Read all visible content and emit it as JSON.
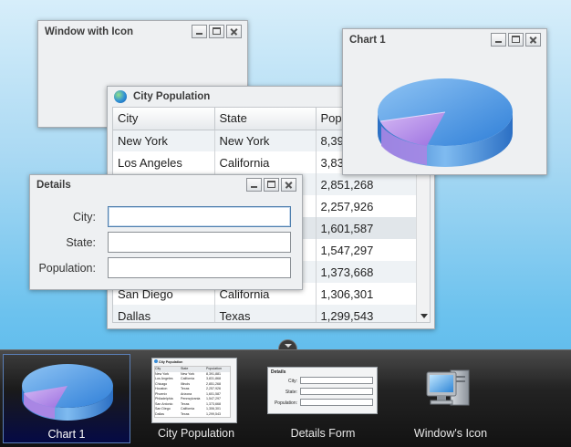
{
  "windows": {
    "icon_window": {
      "title": "Window with Icon"
    },
    "chart_window": {
      "title": "Chart 1"
    },
    "population": {
      "title": "City Population",
      "columns": [
        "City",
        "State",
        "Popula"
      ],
      "rows": [
        {
          "city": "New York",
          "state": "New York",
          "pop": "8,39"
        },
        {
          "city": "Los Angeles",
          "state": "California",
          "pop": "3,83"
        },
        {
          "city": "",
          "state": "",
          "pop": "2,851,268"
        },
        {
          "city": "",
          "state": "",
          "pop": "2,257,926"
        },
        {
          "city": "",
          "state": "",
          "pop": "1,601,587"
        },
        {
          "city": "",
          "state": "",
          "pop": "1,547,297"
        },
        {
          "city": "",
          "state": "",
          "pop": "1,373,668"
        },
        {
          "city": "San Diego",
          "state": "California",
          "pop": "1,306,301"
        },
        {
          "city": "Dallas",
          "state": "Texas",
          "pop": "1,299,543"
        }
      ]
    },
    "details": {
      "title": "Details",
      "fields": [
        {
          "label": "City:",
          "value": ""
        },
        {
          "label": "State:",
          "value": ""
        },
        {
          "label": "Population:",
          "value": ""
        }
      ]
    }
  },
  "taskbar": {
    "items": [
      {
        "label": "Chart 1",
        "active": true
      },
      {
        "label": "City Population",
        "active": false
      },
      {
        "label": "Details Form",
        "active": false
      },
      {
        "label": "Window's Icon",
        "active": false
      }
    ]
  },
  "thumbnails": {
    "population": {
      "title": "City Population",
      "columns": [
        "City",
        "State",
        "Population"
      ],
      "rows": [
        [
          "New York",
          "New York",
          "8,391,881"
        ],
        [
          "Los Angeles",
          "California",
          "3,831,868"
        ],
        [
          "Chicago",
          "Illinois",
          "2,851,268"
        ],
        [
          "Houston",
          "Texas",
          "2,257,926"
        ],
        [
          "Phoenix",
          "Arizona",
          "1,601,587"
        ],
        [
          "Philadelphia",
          "Pennsylvania",
          "1,547,297"
        ],
        [
          "San Antonio",
          "Texas",
          "1,373,668"
        ],
        [
          "San Diego",
          "California",
          "1,306,301"
        ],
        [
          "Dallas",
          "Texas",
          "1,299,543"
        ]
      ]
    },
    "details": {
      "title": "Details",
      "labels": [
        "City:",
        "State:",
        "Population:"
      ]
    }
  },
  "colors": {
    "desktop_top": "#d7eefa",
    "desktop_bottom": "#4bb3ea",
    "pie_main": "#4f9be6",
    "pie_slice": "#b28ae6"
  }
}
